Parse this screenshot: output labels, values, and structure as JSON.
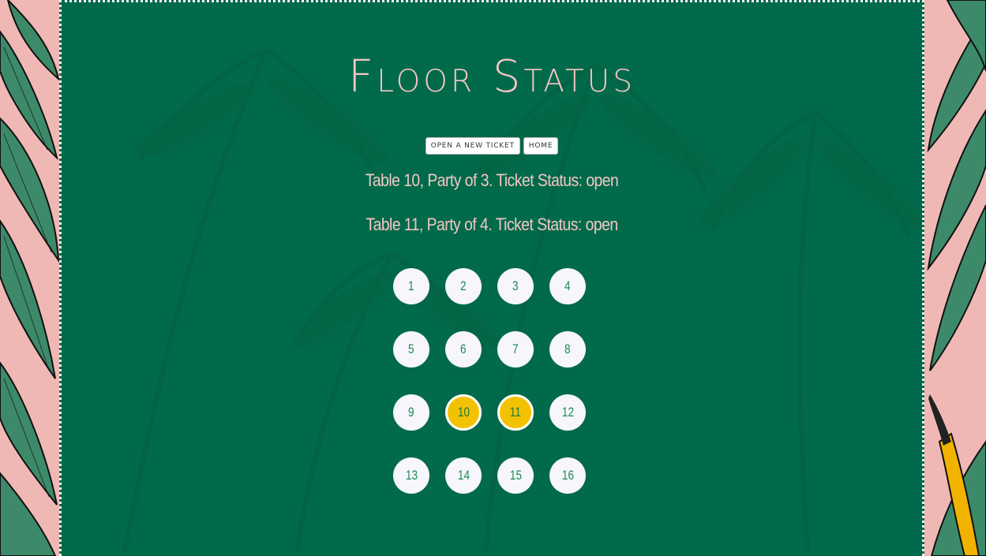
{
  "page": {
    "title": "Floor Status"
  },
  "nav": {
    "open_ticket_label": "Open a new ticket",
    "home_label": "Home"
  },
  "tickets": [
    "Table 10, Party of 3. Ticket Status: open",
    "Table 11, Party of 4. Ticket Status: open"
  ],
  "tables": [
    {
      "number": "1",
      "status": "free"
    },
    {
      "number": "2",
      "status": "free"
    },
    {
      "number": "3",
      "status": "free"
    },
    {
      "number": "4",
      "status": "free"
    },
    {
      "number": "5",
      "status": "free"
    },
    {
      "number": "6",
      "status": "free"
    },
    {
      "number": "7",
      "status": "free"
    },
    {
      "number": "8",
      "status": "free"
    },
    {
      "number": "9",
      "status": "free"
    },
    {
      "number": "10",
      "status": "occupied"
    },
    {
      "number": "11",
      "status": "occupied"
    },
    {
      "number": "12",
      "status": "free"
    },
    {
      "number": "13",
      "status": "free"
    },
    {
      "number": "14",
      "status": "free"
    },
    {
      "number": "15",
      "status": "free"
    },
    {
      "number": "16",
      "status": "free"
    }
  ],
  "colors": {
    "panel": "#006a4a",
    "title": "#f4c6c6",
    "occupied": "#f2c200",
    "free": "#f6f6fc",
    "number": "#1a8a55",
    "outer_background": "#f0b8b4"
  }
}
